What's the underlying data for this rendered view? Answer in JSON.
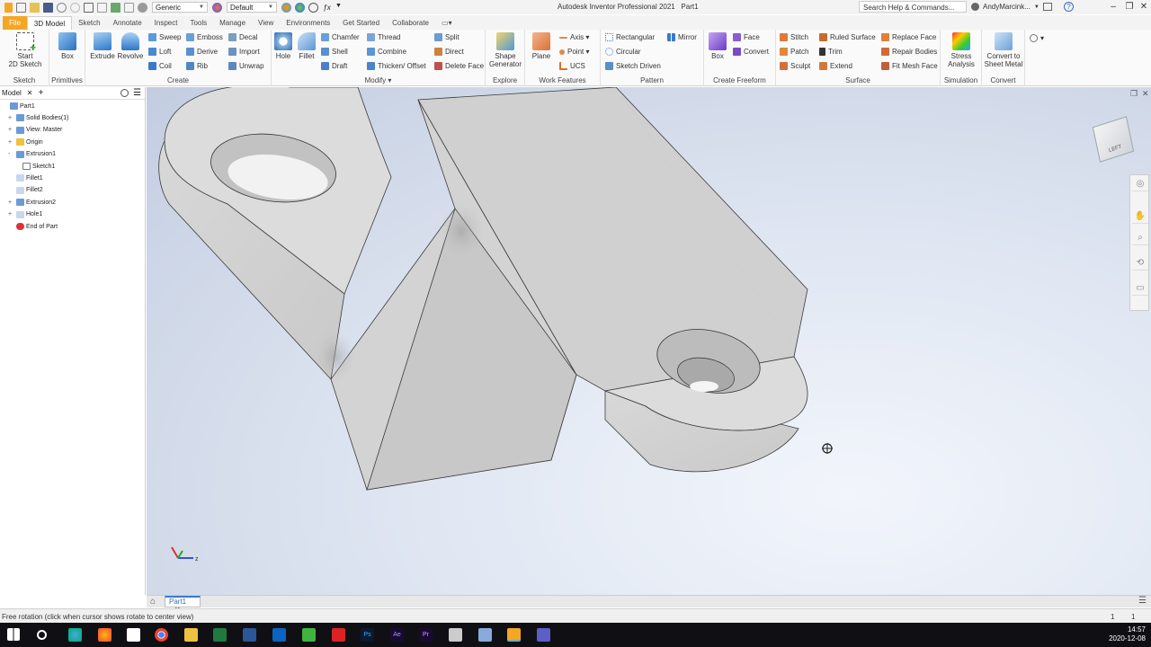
{
  "app": {
    "title": "Autodesk Inventor Professional 2021",
    "document": "Part1",
    "search_placeholder": "Search Help & Commands...",
    "user": "AndyMarcink..."
  },
  "quick_access": {
    "appearance": "Generic",
    "material": "Default"
  },
  "tabs": [
    "File",
    "3D Model",
    "Sketch",
    "Annotate",
    "Inspect",
    "Tools",
    "Manage",
    "View",
    "Environments",
    "Get Started",
    "Collaborate"
  ],
  "ribbon": {
    "sketch": {
      "title": "Sketch",
      "start": "Start",
      "start2": "2D Sketch"
    },
    "primitives": {
      "title": "Primitives",
      "box": "Box"
    },
    "create": {
      "title": "Create",
      "extrude": "Extrude",
      "revolve": "Revolve",
      "sweep": "Sweep",
      "loft": "Loft",
      "coil": "Coil",
      "emboss": "Emboss",
      "derive": "Derive",
      "rib": "Rib",
      "decal": "Decal",
      "import": "Import",
      "unwrap": "Unwrap"
    },
    "modify": {
      "title": "Modify",
      "hole": "Hole",
      "fillet": "Fillet",
      "chamfer": "Chamfer",
      "shell": "Shell",
      "draft": "Draft",
      "thread": "Thread",
      "combine": "Combine",
      "thicken": "Thicken/ Offset",
      "split": "Split",
      "direct": "Direct",
      "delete_face": "Delete Face"
    },
    "explore": {
      "title": "Explore",
      "shape": "Shape",
      "shape2": "Generator"
    },
    "work": {
      "title": "Work Features",
      "plane": "Plane",
      "axis": "Axis",
      "point": "Point",
      "ucs": "UCS"
    },
    "pattern": {
      "title": "Pattern",
      "rect": "Rectangular",
      "circ": "Circular",
      "sketch_driven": "Sketch Driven",
      "mirror": "Mirror"
    },
    "freeform": {
      "title": "Create Freeform",
      "box": "Box",
      "face": "Face",
      "convert": "Convert"
    },
    "surface": {
      "title": "Surface",
      "stitch": "Stitch",
      "patch": "Patch",
      "sculpt": "Sculpt",
      "ruled": "Ruled Surface",
      "trim": "Trim",
      "extend": "Extend",
      "replace": "Replace Face",
      "repair": "Repair Bodies",
      "fitmesh": "Fit Mesh Face"
    },
    "simulation": {
      "title": "Simulation",
      "stress": "Stress",
      "stress2": "Analysis"
    },
    "convert": {
      "title": "Convert",
      "sheet": "Convert to",
      "sheet2": "Sheet Metal"
    }
  },
  "browser": {
    "tab": "Model",
    "tree": [
      {
        "label": "Part1",
        "indent": 0,
        "exp": ""
      },
      {
        "label": "Solid Bodies(1)",
        "indent": 1,
        "exp": "+"
      },
      {
        "label": "View: Master",
        "indent": 1,
        "exp": "+"
      },
      {
        "label": "Origin",
        "indent": 1,
        "exp": "+"
      },
      {
        "label": "Extrusion1",
        "indent": 1,
        "exp": "-"
      },
      {
        "label": "Sketch1",
        "indent": 2,
        "exp": ""
      },
      {
        "label": "Fillet1",
        "indent": 1,
        "exp": ""
      },
      {
        "label": "Fillet2",
        "indent": 1,
        "exp": ""
      },
      {
        "label": "Extrusion2",
        "indent": 1,
        "exp": "+"
      },
      {
        "label": "Hole1",
        "indent": 1,
        "exp": "+"
      },
      {
        "label": "End of Part",
        "indent": 1,
        "exp": ""
      }
    ]
  },
  "viewcube": {
    "label": "LEFT"
  },
  "doc_tab": "Part1",
  "status": {
    "text": "Free rotation (click when cursor shows rotate to center view)",
    "n1": "1",
    "n2": "1"
  },
  "clock": {
    "time": "14:57",
    "date": "2020-12-08"
  },
  "colors": {
    "accent": "#f5a623",
    "viewport": "#d6deec",
    "taskbar": "#101014"
  }
}
